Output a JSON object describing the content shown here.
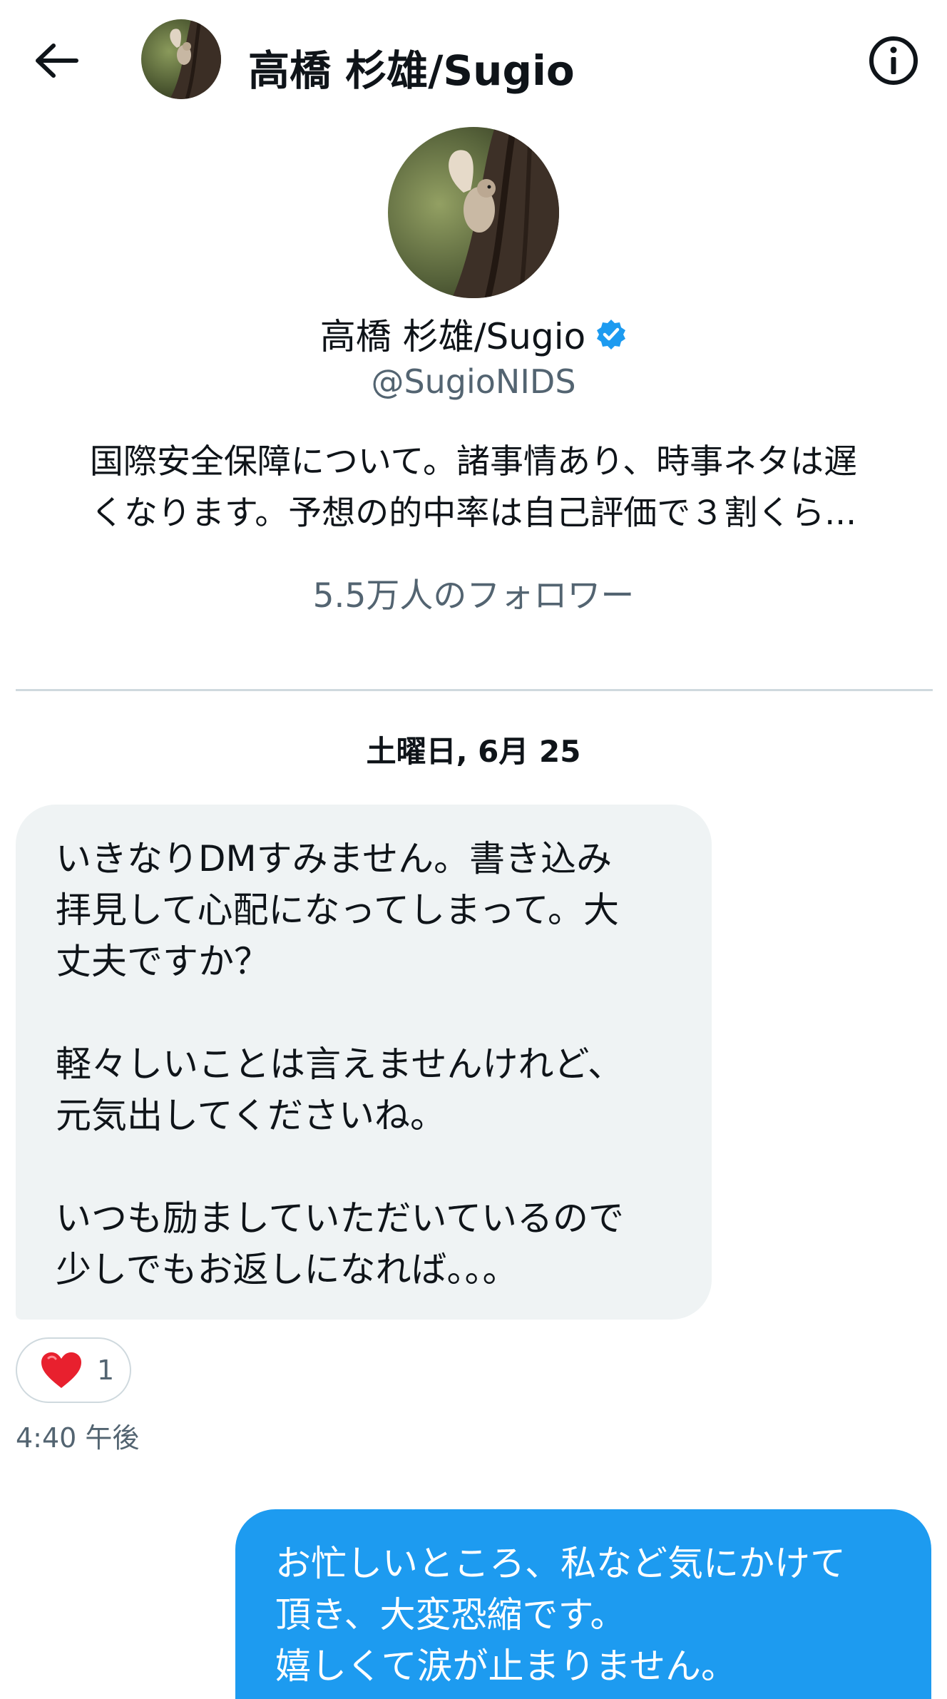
{
  "header": {
    "title": "高橋 杉雄/Sugio",
    "back_icon": "arrow-left-icon",
    "info_icon": "info-icon"
  },
  "profile": {
    "name": "高橋 杉雄/Sugio",
    "verified_icon": "verified-badge-icon",
    "handle": "@SugioNIDS",
    "bio_line_1": "国際安全保障について。諸事情あり、時事ネタは遅",
    "bio_line_2": "くなります。予想の的中率は自己評価で３割くら...",
    "followers": "5.5万人のフォロワー"
  },
  "conversation": {
    "date": "土曜日, 6月 25",
    "incoming": {
      "lines": [
        "いきなりDMすみません。書き込み",
        "拝見して心配になってしまって。大",
        "丈夫ですか？",
        "",
        "軽々しいことは言えませんけれど、",
        "元気出してくださいね。",
        "",
        "いつも励ましていただいているので",
        "少しでもお返しになれば。。。"
      ],
      "reaction_icon": "heart-icon",
      "reaction_count": "1",
      "time": "4:40 午後"
    },
    "outgoing": {
      "lines": [
        "お忙しいところ、私など気にかけて",
        "頂き、大変恐縮です。",
        "嬉しくて涙が止まりません。"
      ]
    }
  },
  "colors": {
    "accent": "#1d9bf0",
    "incoming_bubble": "#eff3f4",
    "secondary_text": "#536471",
    "divider": "#cfd9de",
    "heart": "#f91880"
  }
}
